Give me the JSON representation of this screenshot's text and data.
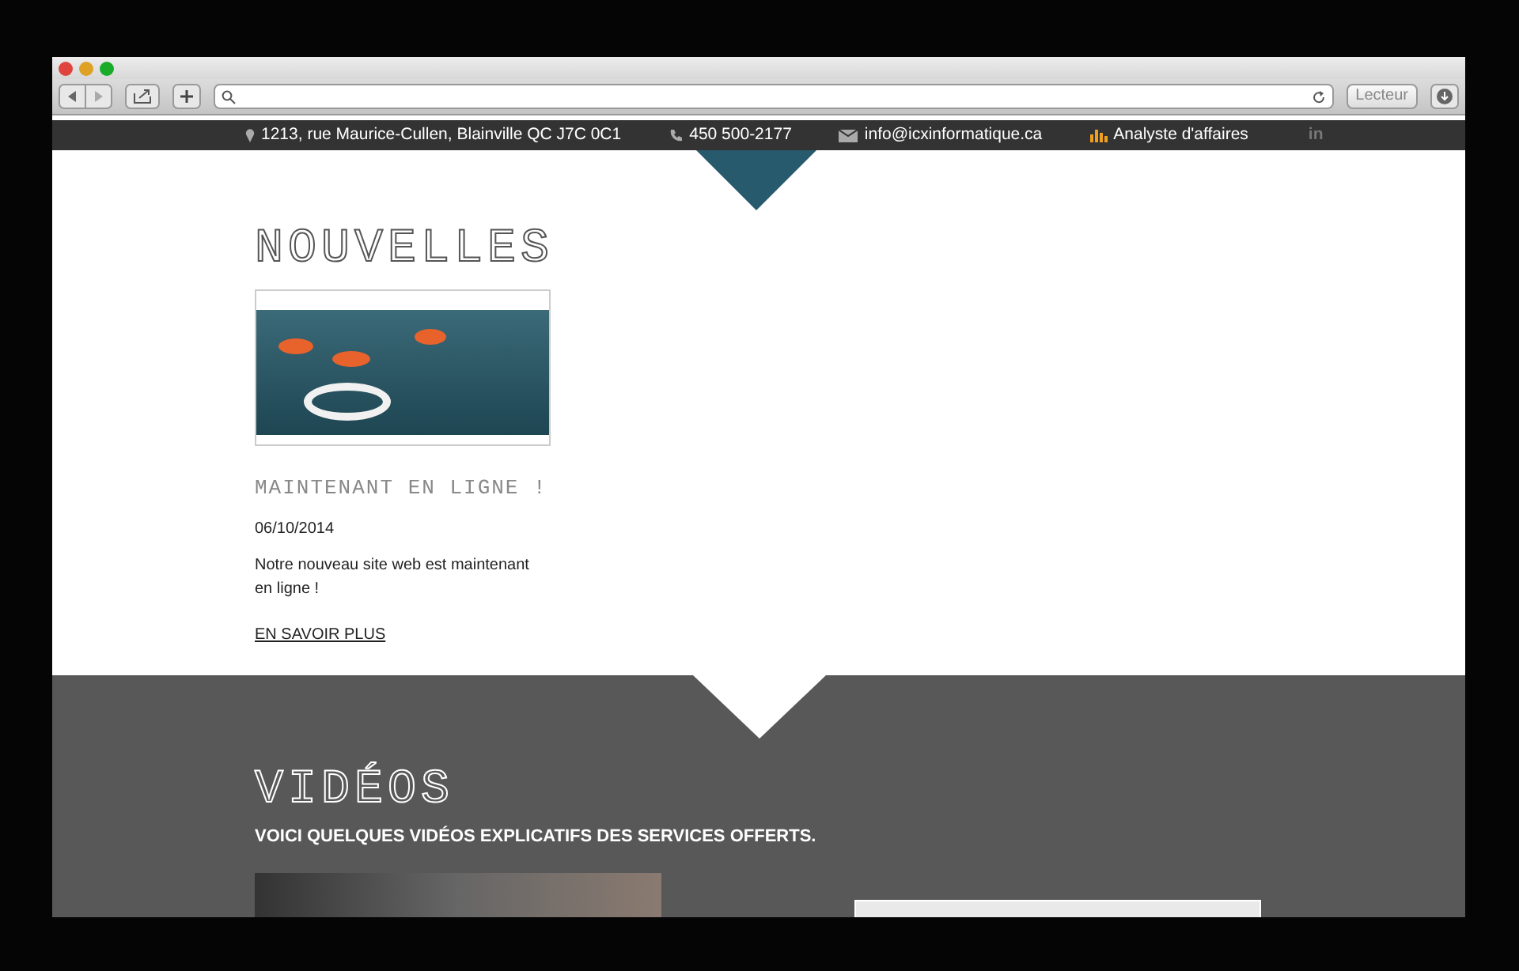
{
  "browser": {
    "reader_button": "Lecteur"
  },
  "topbar": {
    "address": "1213, rue Maurice-Cullen, Blainville QC J7C 0C1",
    "phone": "450 500-2177",
    "email": "info@icxinformatique.ca",
    "link": "Analyste d'affaires",
    "social": "in"
  },
  "news": {
    "title": "NOUVELLES",
    "items": [
      {
        "title": "MAINTENANT EN LIGNE !",
        "date": "06/10/2014",
        "text": "Notre nouveau site web est maintenant en ligne !",
        "link": "EN SAVOIR PLUS"
      }
    ]
  },
  "videos": {
    "title": "VIDÉOS",
    "subtitle": "VOICI QUELQUES VIDÉOS EXPLICATIFS DES SERVICES OFFERTS."
  }
}
